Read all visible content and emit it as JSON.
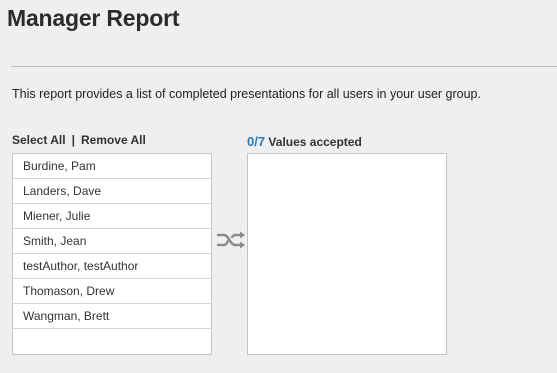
{
  "page": {
    "title": "Manager Report",
    "description": "This report provides a list of completed presentations for all users in your user group."
  },
  "controls": {
    "select_all": "Select All",
    "separator": "|",
    "remove_all": "Remove All"
  },
  "available_list": {
    "items": [
      "Burdine, Pam",
      "Landers, Dave",
      "Miener, Julie",
      "Smith, Jean",
      "testAuthor, testAuthor",
      "Thomason, Drew",
      "Wangman, Brett"
    ]
  },
  "accepted": {
    "count": "0/7",
    "label": "Values accepted",
    "items": []
  },
  "icons": {
    "swap": "shuffle-swap-icon"
  },
  "colors": {
    "accent": "#2a7ab8",
    "icon": "#8a8a8a"
  }
}
